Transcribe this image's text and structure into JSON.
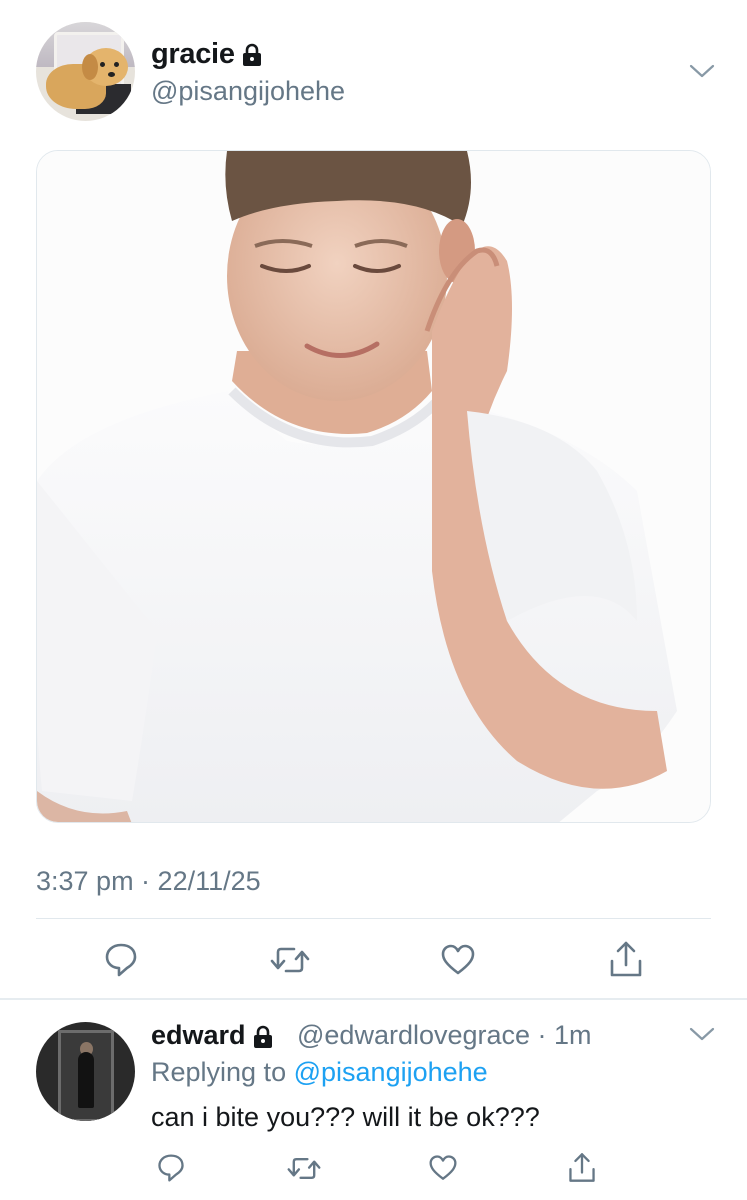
{
  "tweet": {
    "author": {
      "display_name": "gracie",
      "handle": "@pisangijohehe",
      "protected": true,
      "avatar": "golden-retriever-puppy"
    },
    "media": "photo-young-man-white-tshirt-scratching-head",
    "timestamp": "3:37 pm · 22/11/25",
    "actions": [
      "reply-icon",
      "retweet-icon",
      "like-icon",
      "share-icon"
    ]
  },
  "reply": {
    "author": {
      "display_name": "edward",
      "handle": "@edwardlovegrace",
      "protected": true,
      "avatar": "person-in-doorway"
    },
    "meta": "@edwardlovegrace · 1m",
    "replying_prefix": "Replying to",
    "replying_to": "@pisangijohehe",
    "text": "can i bite you??? will it be ok???",
    "actions": [
      "reply-icon",
      "retweet-icon",
      "like-icon",
      "share-icon"
    ]
  },
  "colors": {
    "text": "#14171a",
    "secondary": "#657786",
    "link": "#1da1f2",
    "divider": "#e1e8ed"
  }
}
